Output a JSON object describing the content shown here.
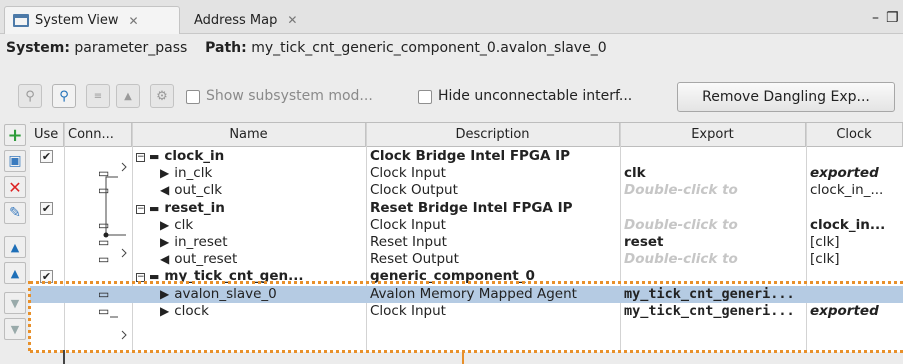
{
  "tabs": [
    {
      "label": "System View",
      "close": "✕"
    },
    {
      "label": "Address Map",
      "close": "✕"
    }
  ],
  "window_controls": {
    "minimize": "–",
    "restore": "❐"
  },
  "info": {
    "system_label": "System:",
    "system_value": "parameter_pass",
    "path_label": "Path:",
    "path_value": "my_tick_cnt_generic_component_0.avalon_slave_0"
  },
  "toolbar": {
    "show_subsystem": "Show subsystem mod...",
    "hide_unconnectable": "Hide unconnectable interf...",
    "remove_dangling": "Remove Dangling Exp..."
  },
  "table": {
    "headers": [
      "Use",
      "Conn...",
      "Name",
      "Description",
      "Export",
      "Clock"
    ],
    "rows": [
      {
        "use": true,
        "expand": "⊟",
        "name": "clock_in",
        "description": "Clock Bridge Intel FPGA IP",
        "export": "",
        "clock": "",
        "kind": "component"
      },
      {
        "name": "in_clk",
        "dir": "in",
        "description": "Clock Input",
        "export": "clk",
        "export_style": "bold",
        "clock": "exported",
        "clock_style": "italicbold"
      },
      {
        "name": "out_clk",
        "dir": "out",
        "description": "Clock Output",
        "export": "Double-click to",
        "export_style": "hint",
        "clock": "clock_in_...",
        "clock_style": ""
      },
      {
        "use": true,
        "expand": "⊟",
        "name": "reset_in",
        "description": "Reset Bridge Intel FPGA IP",
        "export": "",
        "clock": "",
        "kind": "component"
      },
      {
        "name": "clk",
        "dir": "in",
        "description": "Clock Input",
        "export": "Double-click to",
        "export_style": "hint",
        "clock": "clock_in...",
        "clock_style": "bold"
      },
      {
        "name": "in_reset",
        "dir": "in",
        "description": "Reset Input",
        "export": "reset",
        "export_style": "bold",
        "clock": "[clk]",
        "clock_style": ""
      },
      {
        "name": "out_reset",
        "dir": "out",
        "description": "Reset Output",
        "export": "Double-click to",
        "export_style": "hint",
        "clock": "[clk]",
        "clock_style": ""
      },
      {
        "use": true,
        "expand": "⊟",
        "name": "my_tick_cnt_gen...",
        "description": "generic_component_0",
        "export": "",
        "clock": "",
        "kind": "component"
      },
      {
        "name": "avalon_slave_0",
        "dir": "in",
        "description": "Avalon Memory Mapped Agent",
        "export": "my_tick_cnt_generi...",
        "export_style": "mono",
        "clock": "",
        "clock_style": "",
        "selected": true
      },
      {
        "name": "clock",
        "dir": "in",
        "description": "Clock Input",
        "export": "my_tick_cnt_generi...",
        "export_style": "mono",
        "clock": "exported",
        "clock_style": "italicbold"
      }
    ]
  },
  "icons": {
    "tab": "system-view-icon",
    "side": [
      "add-icon",
      "add-component-icon",
      "remove-icon",
      "edit-icon",
      "move-top-icon",
      "move-up-icon",
      "move-down-icon",
      "move-bottom-icon"
    ]
  },
  "colors": {
    "selection": "#b5cbe3",
    "highlight_dots": "#e8902a",
    "add_green": "#2e9c3a",
    "remove_red": "#d22"
  }
}
